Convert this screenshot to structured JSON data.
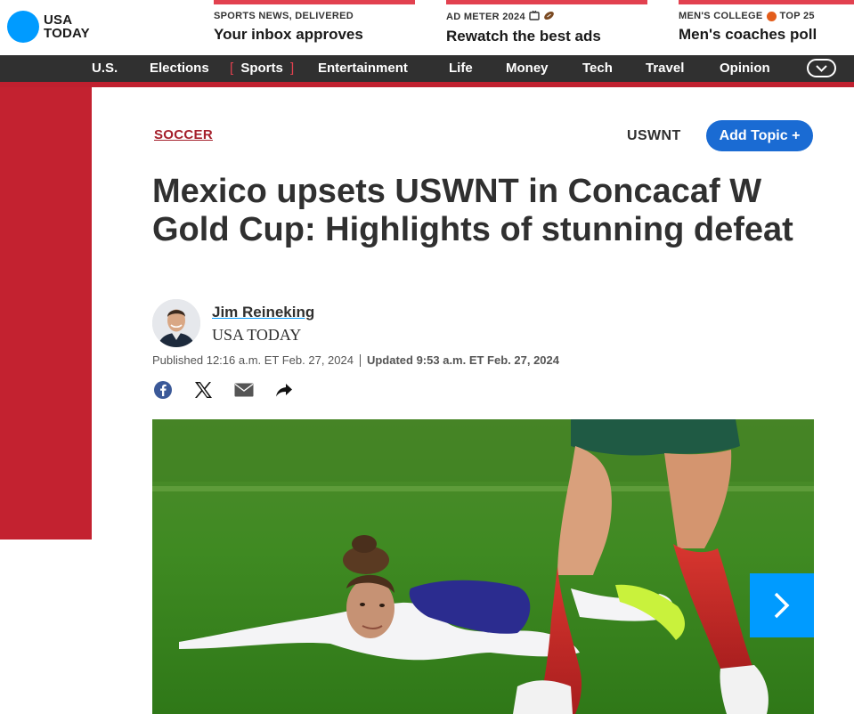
{
  "brand": {
    "line1": "USA",
    "line2": "TODAY"
  },
  "promos": [
    {
      "kicker": "SPORTS NEWS, DELIVERED",
      "title": "Your inbox approves"
    },
    {
      "kicker": "AD METER 2024",
      "title": "Rewatch the best ads"
    },
    {
      "kicker_before": "MEN'S COLLEGE",
      "kicker_after": "TOP 25",
      "title": "Men's coaches poll"
    }
  ],
  "nav": {
    "items": [
      "U.S.",
      "Elections",
      "Sports",
      "Entertainment",
      "Life",
      "Money",
      "Tech",
      "Travel",
      "Opinion"
    ],
    "active": "Sports",
    "bracket_open": "[",
    "bracket_close": "]"
  },
  "article": {
    "section": "SOCCER",
    "topic": "USWNT",
    "add_topic": "Add Topic +",
    "headline": "Mexico upsets USWNT in Concacaf W Gold Cup: Highlights of stunning defeat",
    "author": "Jim Reineking",
    "outlet": "USA TODAY",
    "published": "Published 12:16 a.m. ET Feb. 27, 2024",
    "updated": "Updated 9:53 a.m. ET Feb. 27, 2024"
  },
  "share_icons": [
    "facebook-icon",
    "x-icon",
    "email-icon",
    "share-arrow-icon"
  ],
  "colors": {
    "accent_red": "#c32230",
    "brand_blue": "#009bff",
    "button_blue": "#1a6bd3",
    "nav_bg": "#303030"
  }
}
